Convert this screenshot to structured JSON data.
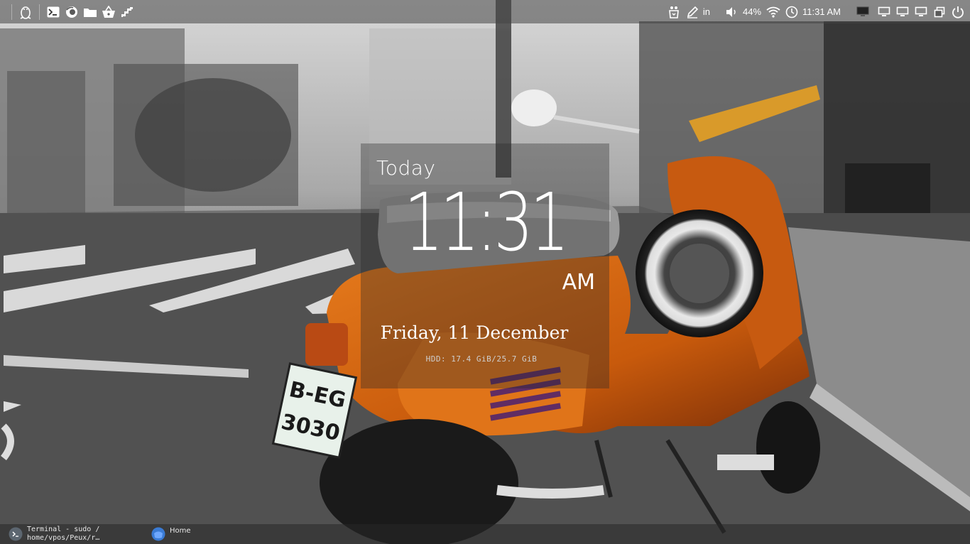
{
  "panel": {
    "left_icons": [
      "linux-tux-icon",
      "terminal-icon",
      "firefox-icon",
      "folder-icon",
      "software-basket-icon",
      "stairs-icon"
    ],
    "right": {
      "keyboard_layout": "in",
      "volume_percent": "44%",
      "clock_time": "11:31 AM",
      "icons": [
        "mascot-icon",
        "pen-icon",
        "speaker-icon",
        "wifi-icon",
        "clock-icon",
        "monitor-icon",
        "workspace-1-icon",
        "workspace-2-icon",
        "workspace-3-icon",
        "window-restore-icon",
        "power-icon"
      ]
    }
  },
  "clock_widget": {
    "day": "Today",
    "time": "11:31",
    "ampm": "AM",
    "date": "Friday, 11 December",
    "hdd": "HDD: 17.4 GiB/25.7 GiB"
  },
  "taskbar": {
    "tasks": [
      {
        "label": "Terminal - sudo /\nhome/vpos/Peux/r…",
        "icon": "terminal-icon"
      },
      {
        "label": "Home",
        "icon": "home-folder-icon"
      }
    ]
  },
  "colors": {
    "scooter_orange": "#d2620e",
    "panel_bg": "#464646"
  }
}
